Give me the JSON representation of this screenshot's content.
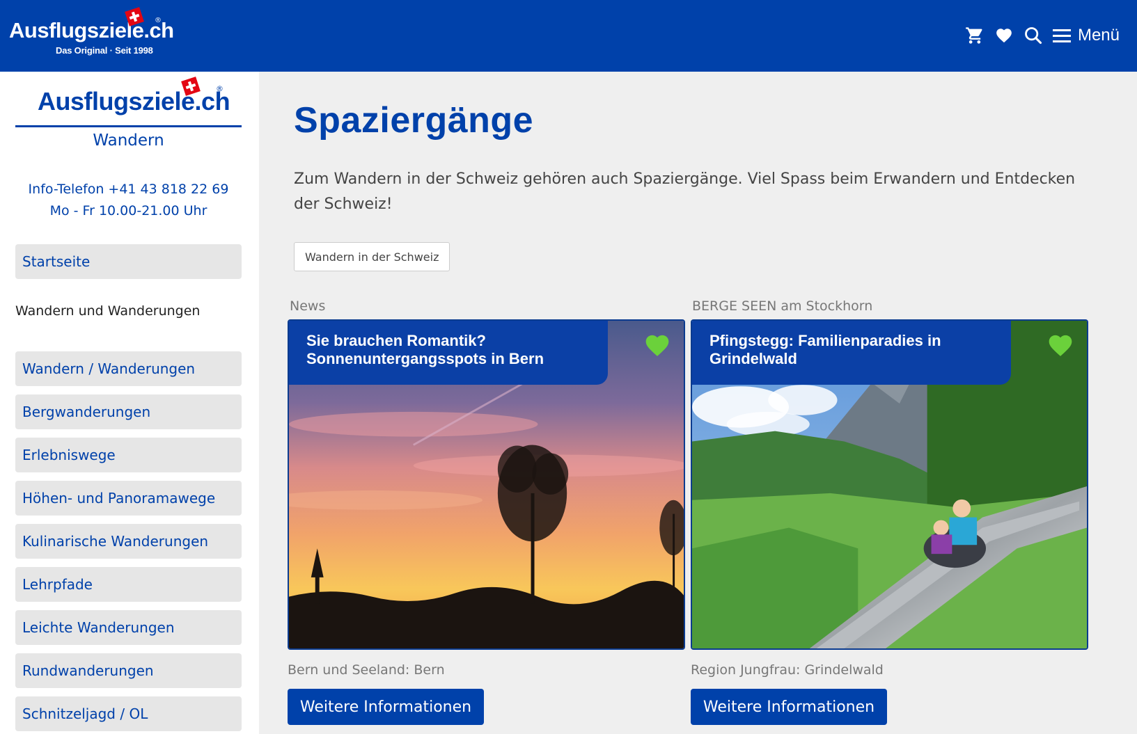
{
  "header": {
    "logo_brand": "Ausflugsziele.ch",
    "logo_tagline": "Das Original · Seit 1998",
    "logo_reg": "®",
    "icons": [
      "cart-icon",
      "heart-icon",
      "search-icon",
      "hamburger-icon"
    ],
    "menu_label": "Menü",
    "background": "#0041aa"
  },
  "sidebar": {
    "logo_brand": "Ausflugsziele.ch",
    "logo_reg": "®",
    "subtitle": "Wandern",
    "info_phone": "Info-Telefon +41 43 818 22 69",
    "info_hours": "Mo - Fr 10.00-21.00 Uhr",
    "top_item": "Startseite",
    "section_heading": "Wandern und Wanderungen",
    "items": [
      "Wandern / Wanderungen",
      "Bergwanderungen",
      "Erlebniswege",
      "Höhen- und Panoramawege",
      "Kulinarische Wanderungen",
      "Lehrpfade",
      "Leichte Wanderungen",
      "Rundwanderungen",
      "Schnitzeljagd / OL"
    ]
  },
  "main": {
    "title": "Spaziergänge",
    "intro": "Zum Wandern in der Schweiz gehören auch Spaziergänge. Viel Spass beim Erwandern und Entdecken der Schweiz!",
    "chip": "Wandern in der Schweiz",
    "cards": [
      {
        "label": "News",
        "title": "Sie brauchen Romantik? Sonnenuntergangsspots in Bern",
        "region": "Bern und Seeland: Bern",
        "button": "Weitere Informationen",
        "favorite_color": "#6bd13b"
      },
      {
        "label": "BERGE SEEN am Stockhorn",
        "title": "Pfingstegg: Familienparadies in Grindelwald",
        "region": "Region Jungfrau: Grindelwald",
        "button": "Weitere Informationen",
        "favorite_color": "#6bd13b"
      }
    ]
  },
  "colors": {
    "brand_blue": "#0041aa",
    "nav_bg": "#e6e6e6",
    "page_bg": "#efefef"
  }
}
